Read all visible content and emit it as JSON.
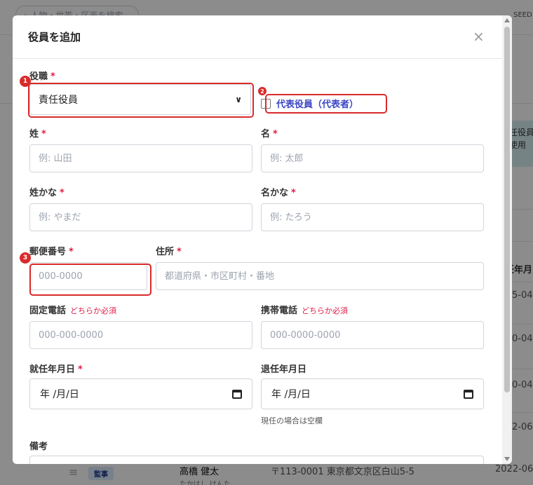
{
  "background": {
    "search_placeholder": "人物・世帯・区画を検索",
    "top_right_text": "SEED",
    "info_text": "任役員て使用",
    "column_header": "任年月",
    "dates": [
      "5-04",
      "0-04",
      "0-04",
      "2-06"
    ],
    "last_row": {
      "role_badge": "監事",
      "name": "高橋 健太",
      "kana": "たかはし けんた",
      "address": "〒113-0001 東京都文京区白山5-5",
      "date": "2022-06"
    }
  },
  "modal": {
    "title": "役員を追加",
    "close": "×",
    "required_mark": "*",
    "role": {
      "label": "役職",
      "value": "責任役員"
    },
    "representative": {
      "label": "代表役員（代表者）"
    },
    "last_name": {
      "label": "姓",
      "placeholder": "例: 山田"
    },
    "first_name": {
      "label": "名",
      "placeholder": "例: 太郎"
    },
    "last_name_kana": {
      "label": "姓かな",
      "placeholder": "例: やまだ"
    },
    "first_name_kana": {
      "label": "名かな",
      "placeholder": "例: たろう"
    },
    "postal_code": {
      "label": "郵便番号",
      "placeholder": "000-0000"
    },
    "address": {
      "label": "住所",
      "placeholder": "都道府県・市区町村・番地"
    },
    "landline": {
      "label": "固定電話",
      "hint": "どちらか必須",
      "placeholder": "000-000-0000"
    },
    "mobile": {
      "label": "携帯電話",
      "hint": "どちらか必須",
      "placeholder": "000-0000-0000"
    },
    "appointed_date": {
      "label": "就任年月日",
      "value": "年 /月/日"
    },
    "retired_date": {
      "label": "退任年月日",
      "value": "年 /月/日",
      "note": "現任の場合は空欄"
    },
    "remarks": {
      "label": "備考"
    }
  },
  "annotations": [
    "1",
    "2",
    "3"
  ],
  "colors": {
    "accent": "#3b46c4",
    "required": "#e11d48",
    "highlight": "#d92b2b"
  }
}
